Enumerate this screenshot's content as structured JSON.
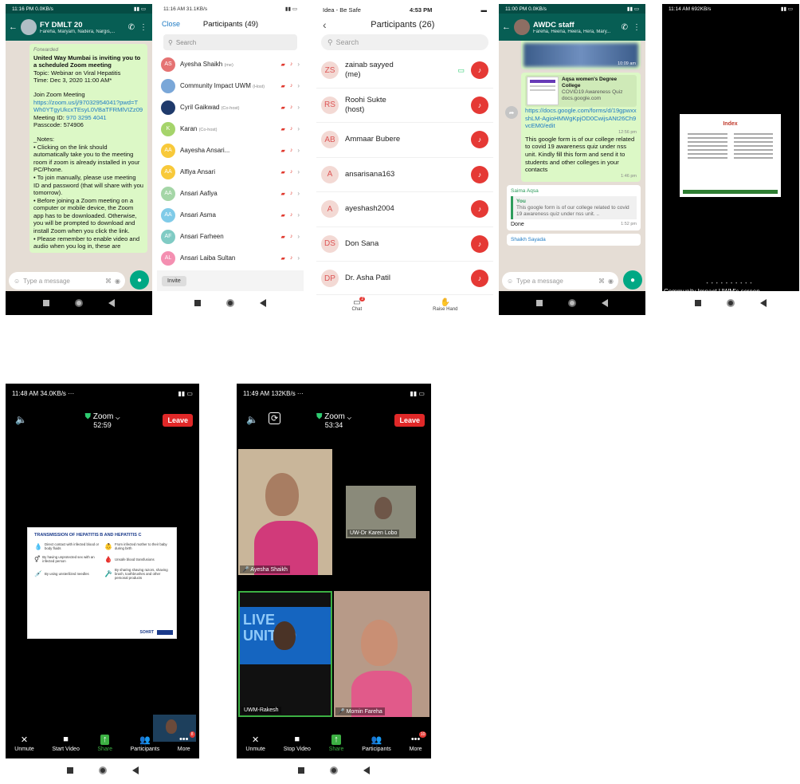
{
  "s1": {
    "status_time": "11:16 PM",
    "status_speed": "0.0KB/s",
    "title": "FY DMLT 20",
    "subtitle": "Fareha, Maryam, Nadera, Nargis,...",
    "forwarded": "Forwarded",
    "msg_bold": "United Way Mumbai is inviting you to a scheduled Zoom meeting",
    "topic": "Topic: Webinar on Viral Hepatitis",
    "time": "Time: Dec 3, 2020 11:00 AM*",
    "join": "Join Zoom Meeting",
    "link": "https://zoom.us/j/97032954041?pwd=TWh0YTgyUkcxTEsyL0VBaTFRMlVIZz09",
    "meeting_id_label": "Meeting ID:",
    "meeting_id": "970 3295 4041",
    "passcode": "Passcode: 574906",
    "notes_head": "_Notes:",
    "note1": "• Clicking on the link should automatically take you to the meeting room if zoom is already installed in your PC/Phone.",
    "note2": "• To join manually, please use meeting ID and password (that will share with you tomorrow).",
    "note3": "• Before joining a Zoom meeting on a computer or mobile device, the Zoom app has to be downloaded. Otherwise, you will be prompted to download and install Zoom when you click the link.",
    "note4": "• Please remember to enable video and audio when you log in, these are",
    "input_placeholder": "Type a message"
  },
  "s2": {
    "status_time": "11:16 AM",
    "status_speed": "31.1KB/s",
    "close": "Close",
    "title": "Participants (49)",
    "search": "Search",
    "rows": [
      {
        "initials": "AS",
        "name": "Ayesha Shaikh",
        "tag": "(me)",
        "color": "#e57373"
      },
      {
        "initials": "",
        "name": "Community Impact UWM",
        "tag": "(Host)",
        "color": "#7aa7d8"
      },
      {
        "initials": "",
        "name": "Cyril Gaikwad",
        "tag": "(Co-host)",
        "color": "#1f3a6b"
      },
      {
        "initials": "K",
        "name": "Karan",
        "tag": "(Co-host)",
        "color": "#a5d46b"
      },
      {
        "initials": "AA",
        "name": "Aayesha Ansari...",
        "tag": "",
        "color": "#f8c93a"
      },
      {
        "initials": "AA",
        "name": "Alfiya Ansari",
        "tag": "",
        "color": "#f8c93a"
      },
      {
        "initials": "AA",
        "name": "Ansari Aafiya",
        "tag": "",
        "color": "#a5d6a7"
      },
      {
        "initials": "AA",
        "name": "Ansari Asma",
        "tag": "",
        "color": "#80cbe8"
      },
      {
        "initials": "AF",
        "name": "Ansari Farheen",
        "tag": "",
        "color": "#80cbc4"
      },
      {
        "initials": "AL",
        "name": "Ansari Laiba Sultan",
        "tag": "",
        "color": "#f48fb1"
      }
    ],
    "invite": "Invite"
  },
  "s3": {
    "carrier": "Idea - Be Safe",
    "status_time": "4:53 PM",
    "title": "Participants (26)",
    "search": "Search",
    "rows": [
      {
        "initials": "ZS",
        "name": "zainab sayyed",
        "sub": "(me)"
      },
      {
        "initials": "RS",
        "name": "Roohi Sukte",
        "sub": "(host)"
      },
      {
        "initials": "AB",
        "name": "Ammaar Bubere",
        "sub": ""
      },
      {
        "initials": "A",
        "name": "ansarisana163",
        "sub": ""
      },
      {
        "initials": "A",
        "name": "ayeshash2004",
        "sub": ""
      },
      {
        "initials": "DS",
        "name": "Don Sana",
        "sub": ""
      },
      {
        "initials": "DP",
        "name": "Dr. Asha Patil",
        "sub": ""
      }
    ],
    "chat": "Chat",
    "chat_badge": "2",
    "raise_hand": "Raise Hand"
  },
  "s4": {
    "status_time": "11:00 PM",
    "status_speed": "0.0KB/s",
    "title": "AWDC staff",
    "subtitle": "Fareha, Heena, Heera, Hera, Mary...",
    "img_time": "10:09 am",
    "card_title": "Aqsa women's Degree College",
    "card_sub": "COVID19 Awareness Quiz",
    "card_domain": "docs.google.com",
    "form_link": "https://docs.google.com/forms/d/19gpwxxshLM-AgioHMWgKpjOD0CwijsANt26Ch9vcEM0/edit",
    "link_time": "12:56 pm",
    "msg": "This google form is of our college related to covid 19 awareness quiz under nss unit. Kindly fill this form and send it to students and other colleges in your contacts",
    "msg_time": "1:46 pm",
    "sender1": "Saima Aqsa",
    "quote_from": "You",
    "quote_text": "This google form is of our college related to covid 19 awareness quiz under nss unit. ..",
    "reply": "Done",
    "reply_time": "1:52 pm",
    "sender2": "Shaikh Sayada",
    "input_placeholder": "Type a message"
  },
  "s5": {
    "status_time": "11:14 AM",
    "status_speed": "692KB/s",
    "slide_title": "Index",
    "caption": "Community Impact UWM's screen"
  },
  "s6": {
    "status_time": "11:48 AM",
    "status_speed": "34.0KB/s",
    "app": "Zoom",
    "timer": "52:59",
    "leave": "Leave",
    "slide_title": "TRANSMISSION OF HEPATITIS B AND HEPATITIS C",
    "items": [
      "Direct contact with infected blood or body fluids",
      "From infected mother to their baby during birth",
      "By having unprotected sex with an infected person",
      "Unsafe blood transfusions",
      "By using unsterilized needles",
      "By sharing shaving razors, shaving brush, toothbrushes and other personal products"
    ],
    "slide_brand": "SOHRT",
    "buttons": [
      "Unmute",
      "Start Video",
      "Share",
      "Participants",
      "More"
    ],
    "more_badge": "8"
  },
  "s7": {
    "status_time": "11:49 AM",
    "status_speed": "132KB/s",
    "app": "Zoom",
    "timer": "53:34",
    "leave": "Leave",
    "tiles": [
      "Ayesha Shaikh",
      "UW-Dr Karen Lobo",
      "UWM-Rakesh",
      "Momin Fareha"
    ],
    "banner": "LIVE UNITED",
    "buttons": [
      "Unmute",
      "Stop Video",
      "Share",
      "Participants",
      "More"
    ],
    "more_badge": "10"
  }
}
